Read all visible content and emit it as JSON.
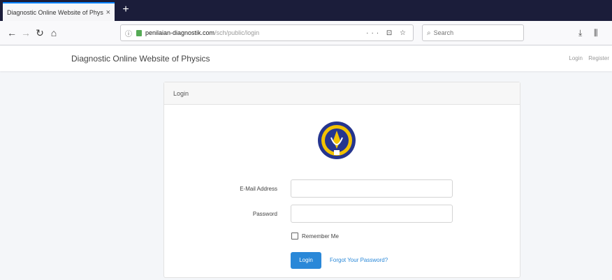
{
  "browser": {
    "tab_title": "Diagnostic Online Website of Physics",
    "tab_close": "×",
    "new_tab": "+",
    "url_host": "penilaian-diagnostik.com",
    "url_path": "/sch/public/login",
    "url_actions": "··· ⊡ ☆",
    "search_placeholder": "Search"
  },
  "site": {
    "brand": "Diagnostic Online Website of Physics",
    "nav": {
      "login": "Login",
      "register": "Register"
    }
  },
  "card": {
    "header": "Login",
    "email_label": "E-Mail Address",
    "email_value": "",
    "password_label": "Password",
    "password_value": "",
    "remember_label": "Remember Me",
    "remember_checked": false,
    "login_button": "Login",
    "forgot_link": "Forgot Your Password?"
  },
  "colors": {
    "accent": "#2a88d8",
    "tabbar": "#1b1d3a",
    "logo_ring": "#f2c200",
    "logo_blue": "#25358f"
  }
}
